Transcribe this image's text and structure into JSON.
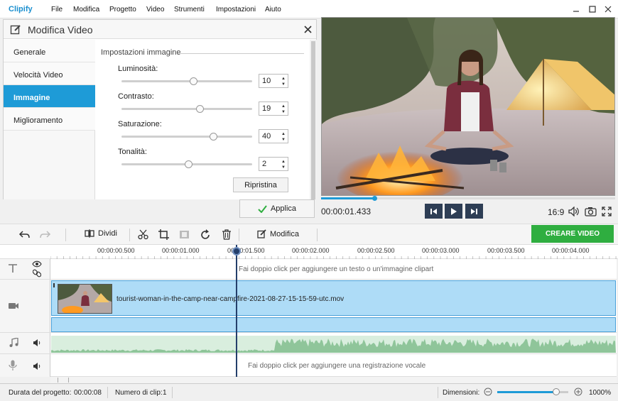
{
  "app": {
    "name": "Clipify"
  },
  "menu": [
    "File",
    "Modifica",
    "Progetto",
    "Video",
    "Strumenti",
    "Impostazioni",
    "Aiuto"
  ],
  "panel": {
    "title": "Modifica Video",
    "sidebar": [
      "Generale",
      "Velocità Video",
      "Immagine",
      "Miglioramento"
    ],
    "active_index": 2,
    "section_title": "Impostazioni immagine",
    "sliders": [
      {
        "label": "Luminosità:",
        "value": "10",
        "fraction": 0.55
      },
      {
        "label": "Contrasto:",
        "value": "19",
        "fraction": 0.6
      },
      {
        "label": "Saturazione:",
        "value": "40",
        "fraction": 0.7
      },
      {
        "label": "Tonalità:",
        "value": "2",
        "fraction": 0.51
      }
    ],
    "reset_label": "Ripristina",
    "apply_label": "Applica"
  },
  "player": {
    "timecode": "00:00:01.433",
    "aspect": "16:9",
    "progress_fraction": 0.18
  },
  "toolbar": {
    "split_label": "Dividi",
    "edit_label": "Modifica",
    "create_label": "CREARE VIDEO"
  },
  "ruler": [
    "00:00:00.500",
    "00:00:01.000",
    "00:00:01.500",
    "00:00:02.000",
    "00:00:02.500",
    "00:00:03.000",
    "00:00:03.500",
    "00:00:04.000"
  ],
  "timeline": {
    "text_hint": "Fai doppio click per aggiungere un testo o un'immagine clipart",
    "clip_name": "tourist-woman-in-the-camp-near-campfire-2021-08-27-15-15-59-utc.mov",
    "voice_hint": "Fai doppio click per aggiungere una registrazione vocale"
  },
  "status": {
    "duration_label": "Durata del progetto:",
    "duration": "00:00:08",
    "clips_label": "Numero di clip:",
    "clips": "1",
    "zoom_label": "Dimensioni:",
    "zoom": "1000%",
    "zoom_fraction": 0.83
  },
  "colors": {
    "accent": "#1e9bd7",
    "create": "#2fae40",
    "playhead": "#243f6b"
  }
}
